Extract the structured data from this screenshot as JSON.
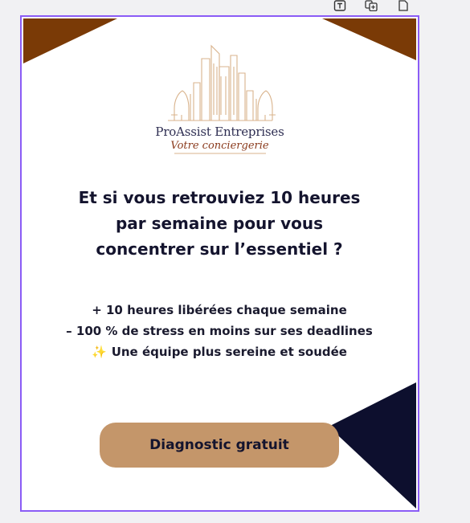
{
  "toolbar": {
    "icons": [
      "text-box-icon",
      "duplicate-page-icon",
      "add-page-icon"
    ]
  },
  "brand": {
    "name": "ProAssist Entreprises",
    "tagline": "Votre conciergerie"
  },
  "headline": {
    "lines": [
      "Et si vous retrouviez 10 heures",
      "par semaine pour vous",
      "concentrer sur l’essentiel ?"
    ]
  },
  "benefits": [
    {
      "icon": "",
      "text": "+ 10 heures libérées chaque semaine"
    },
    {
      "icon": "",
      "text": "– 100 % de stress en moins sur ses deadlines"
    },
    {
      "icon": "✨",
      "text": "Une équipe plus sereine et soudée"
    }
  ],
  "cta": {
    "label": "Diagnostic gratuit"
  },
  "colors": {
    "frame_border": "#8b5cf6",
    "corner_brown": "#7a3a06",
    "navy_triangle": "#0d0f2e",
    "cta_background": "#c4966a",
    "text_dark": "#14142e",
    "logo_line": "#d9b38c"
  }
}
